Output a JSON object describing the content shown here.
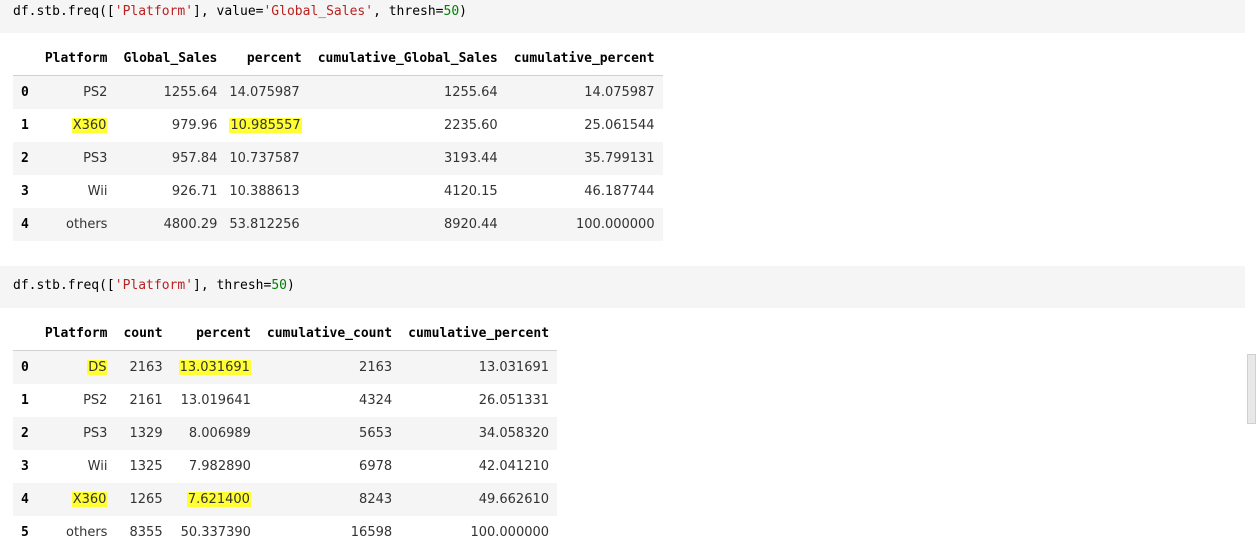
{
  "cell1": {
    "code_prefix": "df.stb.freq([",
    "code_str1": "'Platform'",
    "code_mid1": "], value=",
    "code_str2": "'Global_Sales'",
    "code_mid2": ", thresh=",
    "code_num": "50",
    "code_suffix": ")"
  },
  "table1": {
    "columns": [
      "",
      "Platform",
      "Global_Sales",
      "percent",
      "cumulative_Global_Sales",
      "cumulative_percent"
    ],
    "rows": [
      {
        "index": "0",
        "Platform": "PS2",
        "Global_Sales": "1255.64",
        "percent": "14.075987",
        "cumulative_Global_Sales": "1255.64",
        "cumulative_percent": "14.075987"
      },
      {
        "index": "1",
        "Platform": "X360",
        "Global_Sales": "979.96",
        "percent": "10.985557",
        "cumulative_Global_Sales": "2235.60",
        "cumulative_percent": "25.061544"
      },
      {
        "index": "2",
        "Platform": "PS3",
        "Global_Sales": "957.84",
        "percent": "10.737587",
        "cumulative_Global_Sales": "3193.44",
        "cumulative_percent": "35.799131"
      },
      {
        "index": "3",
        "Platform": "Wii",
        "Global_Sales": "926.71",
        "percent": "10.388613",
        "cumulative_Global_Sales": "4120.15",
        "cumulative_percent": "46.187744"
      },
      {
        "index": "4",
        "Platform": "others",
        "Global_Sales": "4800.29",
        "percent": "53.812256",
        "cumulative_Global_Sales": "8920.44",
        "cumulative_percent": "100.000000"
      }
    ]
  },
  "cell2": {
    "code_prefix": "df.stb.freq([",
    "code_str1": "'Platform'",
    "code_mid1": "], thresh=",
    "code_num": "50",
    "code_suffix": ")"
  },
  "table2": {
    "columns": [
      "",
      "Platform",
      "count",
      "percent",
      "cumulative_count",
      "cumulative_percent"
    ],
    "rows": [
      {
        "index": "0",
        "Platform": "DS",
        "count": "2163",
        "percent": "13.031691",
        "cumulative_count": "2163",
        "cumulative_percent": "13.031691"
      },
      {
        "index": "1",
        "Platform": "PS2",
        "count": "2161",
        "percent": "13.019641",
        "cumulative_count": "4324",
        "cumulative_percent": "26.051331"
      },
      {
        "index": "2",
        "Platform": "PS3",
        "count": "1329",
        "percent": "8.006989",
        "cumulative_count": "5653",
        "cumulative_percent": "34.058320"
      },
      {
        "index": "3",
        "Platform": "Wii",
        "count": "1325",
        "percent": "7.982890",
        "cumulative_count": "6978",
        "cumulative_percent": "42.041210"
      },
      {
        "index": "4",
        "Platform": "X360",
        "count": "1265",
        "percent": "7.621400",
        "cumulative_count": "8243",
        "cumulative_percent": "49.662610"
      },
      {
        "index": "5",
        "Platform": "others",
        "count": "8355",
        "percent": "50.337390",
        "cumulative_count": "16598",
        "cumulative_percent": "100.000000"
      }
    ]
  },
  "colors": {
    "highlight": "#ffff33",
    "code_cell_bg": "#f5f5f5",
    "string_color": "#ba2121",
    "number_color": "#008000",
    "stripe_row": "#f5f5f5"
  }
}
